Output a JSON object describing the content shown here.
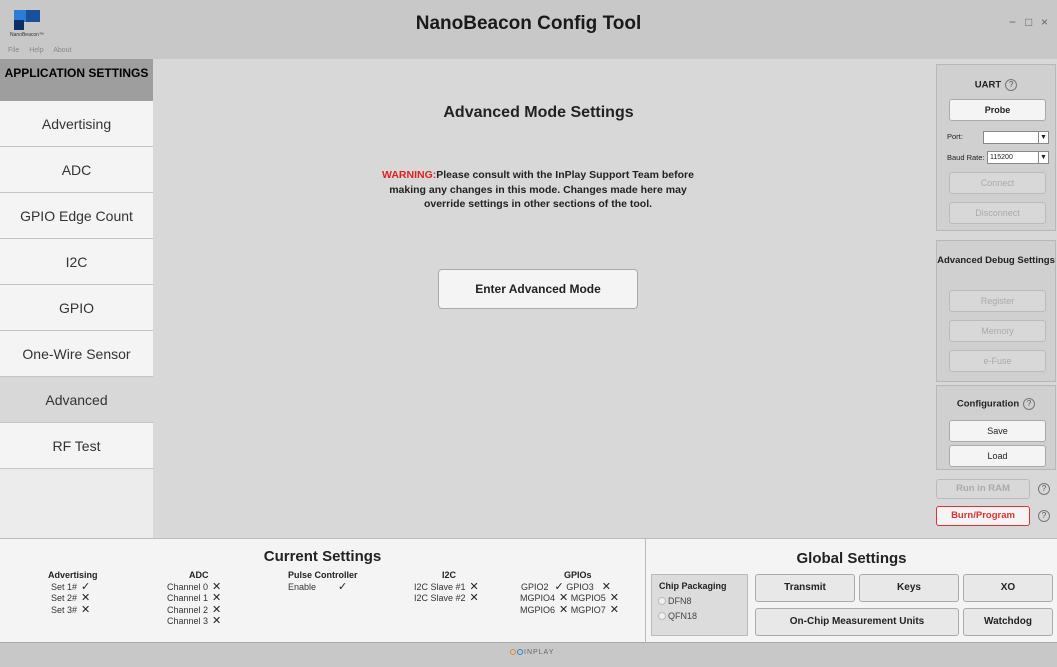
{
  "window": {
    "title": "NanoBeacon Config Tool",
    "logo_text": "NanoBeacon™",
    "controls": {
      "minimize": "−",
      "maximize": "□",
      "close": "×"
    }
  },
  "menu": [
    "File",
    "Help",
    "About"
  ],
  "sidebar": {
    "header": "APPLICATION SETTINGS",
    "items": [
      {
        "label": "Advertising"
      },
      {
        "label": "ADC"
      },
      {
        "label": "GPIO Edge Count"
      },
      {
        "label": "I2C"
      },
      {
        "label": "GPIO"
      },
      {
        "label": "One-Wire Sensor"
      },
      {
        "label": "Advanced",
        "active": true
      },
      {
        "label": "RF Test"
      }
    ]
  },
  "main": {
    "title": "Advanced Mode Settings",
    "warning_label": "WARNING:",
    "warning_text": "Please consult with the InPlay Support Team before making any changes in this mode. Changes made here may override settings in other sections of the tool.",
    "enter_button": "Enter Advanced Mode"
  },
  "uart": {
    "title": "UART",
    "probe": "Probe",
    "port_label": "Port:",
    "port_value": "",
    "baud_label": "Baud Rate:",
    "baud_value": "115200",
    "connect": "Connect",
    "disconnect": "Disconnect"
  },
  "debug": {
    "title": "Advanced Debug Settings",
    "register": "Register",
    "memory": "Memory",
    "efuse": "e-Fuse"
  },
  "configuration": {
    "title": "Configuration",
    "save": "Save",
    "load": "Load"
  },
  "actions": {
    "run_in_ram": "Run in RAM",
    "burn_program": "Burn/Program"
  },
  "current_settings": {
    "title": "Current Settings",
    "advertising": {
      "head": "Advertising",
      "rows": [
        "Set 1#",
        "Set 2#",
        "Set 3#"
      ]
    },
    "adc": {
      "head": "ADC",
      "rows": [
        "Channel 0",
        "Channel 1",
        "Channel 2",
        "Channel 3"
      ]
    },
    "pulse": {
      "head": "Pulse Controller",
      "rows": [
        "Enable"
      ]
    },
    "i2c": {
      "head": "I2C",
      "rows": [
        "I2C Slave #1",
        "I2C Slave #2"
      ]
    },
    "gpios": {
      "head": "GPIOs",
      "rows": [
        "GPIO2",
        "GPIO3",
        "MGPIO4",
        "MGPIO5",
        "MGPIO6",
        "MGPIO7"
      ]
    }
  },
  "global_settings": {
    "title": "Global Settings",
    "chip_packaging": "Chip Packaging",
    "options": [
      "DFN8",
      "QFN18"
    ],
    "transmit": "Transmit",
    "keys": "Keys",
    "xo": "XO",
    "units": "On-Chip Measurement Units",
    "watchdog": "Watchdog"
  },
  "footer": {
    "brand": "INPLAY"
  },
  "colors": {
    "warning": "#e02020",
    "burn": "#e03030",
    "brand_blue": "#2a7fd4"
  }
}
